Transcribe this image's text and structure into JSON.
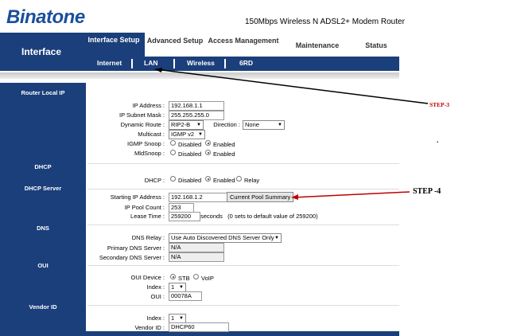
{
  "header": {
    "logo_text": "Binatone",
    "model": "150Mbps Wireless N ADSL2+ Modem Router"
  },
  "nav": {
    "brand": "Interface",
    "tabs": [
      {
        "label": "Interface Setup",
        "active": true
      },
      {
        "label": "Advanced Setup"
      },
      {
        "label": "Access Management"
      },
      {
        "label": "Maintenance"
      },
      {
        "label": "Status"
      }
    ],
    "subtabs": [
      "Internet",
      "LAN",
      "Wireless",
      "6RD"
    ]
  },
  "sections": {
    "router_local_ip": "Router Local IP",
    "dhcp": "DHCP",
    "dhcp_server": "DHCP Server",
    "dns": "DNS",
    "oui": "OUI",
    "vendor_id": "Vendor ID"
  },
  "router": {
    "ip_label": "IP Address :",
    "ip_value": "192.168.1.1",
    "mask_label": "IP Subnet Mask :",
    "mask_value": "255.255.255.0",
    "dynamic_route_label": "Dynamic Route :",
    "dynamic_route_value": "RIP2-B",
    "direction_label": "Direction :",
    "direction_value": "None",
    "multicast_label": "Multicast :",
    "multicast_value": "IGMP v2",
    "igmp_label": "IGMP Snoop :",
    "mld_label": "MldSnoop :",
    "disabled": "Disabled",
    "enabled": "Enabled"
  },
  "dhcp": {
    "dhcp_label": "DHCP :",
    "disabled": "Disabled",
    "enabled": "Enabled",
    "relay": "Relay",
    "start_ip_label": "Starting IP Address :",
    "start_ip_value": "192.168.1.2",
    "pool_button": "Current Pool Summary",
    "pool_count_label": "IP Pool Count :",
    "pool_count_value": "253",
    "lease_label": "Lease Time :",
    "lease_value": "259200",
    "lease_note": "seconds   (0 sets to default value of 259200)"
  },
  "dns": {
    "relay_label": "DNS Relay :",
    "relay_value": "Use Auto Discovered DNS Server Only",
    "primary_label": "Primary DNS Server :",
    "primary_value": "N/A",
    "secondary_label": "Secondary DNS Server :",
    "secondary_value": "N/A"
  },
  "oui": {
    "device_label": "OUI Device :",
    "stb": "STB",
    "voip": "VoIP",
    "index_label": "Index :",
    "index_value": "1",
    "oui_label": "OUI :",
    "oui_value": "00078A"
  },
  "vendor": {
    "index_label": "Index :",
    "index_value": "1",
    "vendor_label": "Vendor ID :",
    "vendor_value": "DHCP60"
  },
  "annotations": {
    "step3": "STEP-3",
    "step4": "STEP -4",
    "dot": "."
  },
  "colors": {
    "brand_blue": "#1b3f7a",
    "arrow_red": "#c00000"
  }
}
